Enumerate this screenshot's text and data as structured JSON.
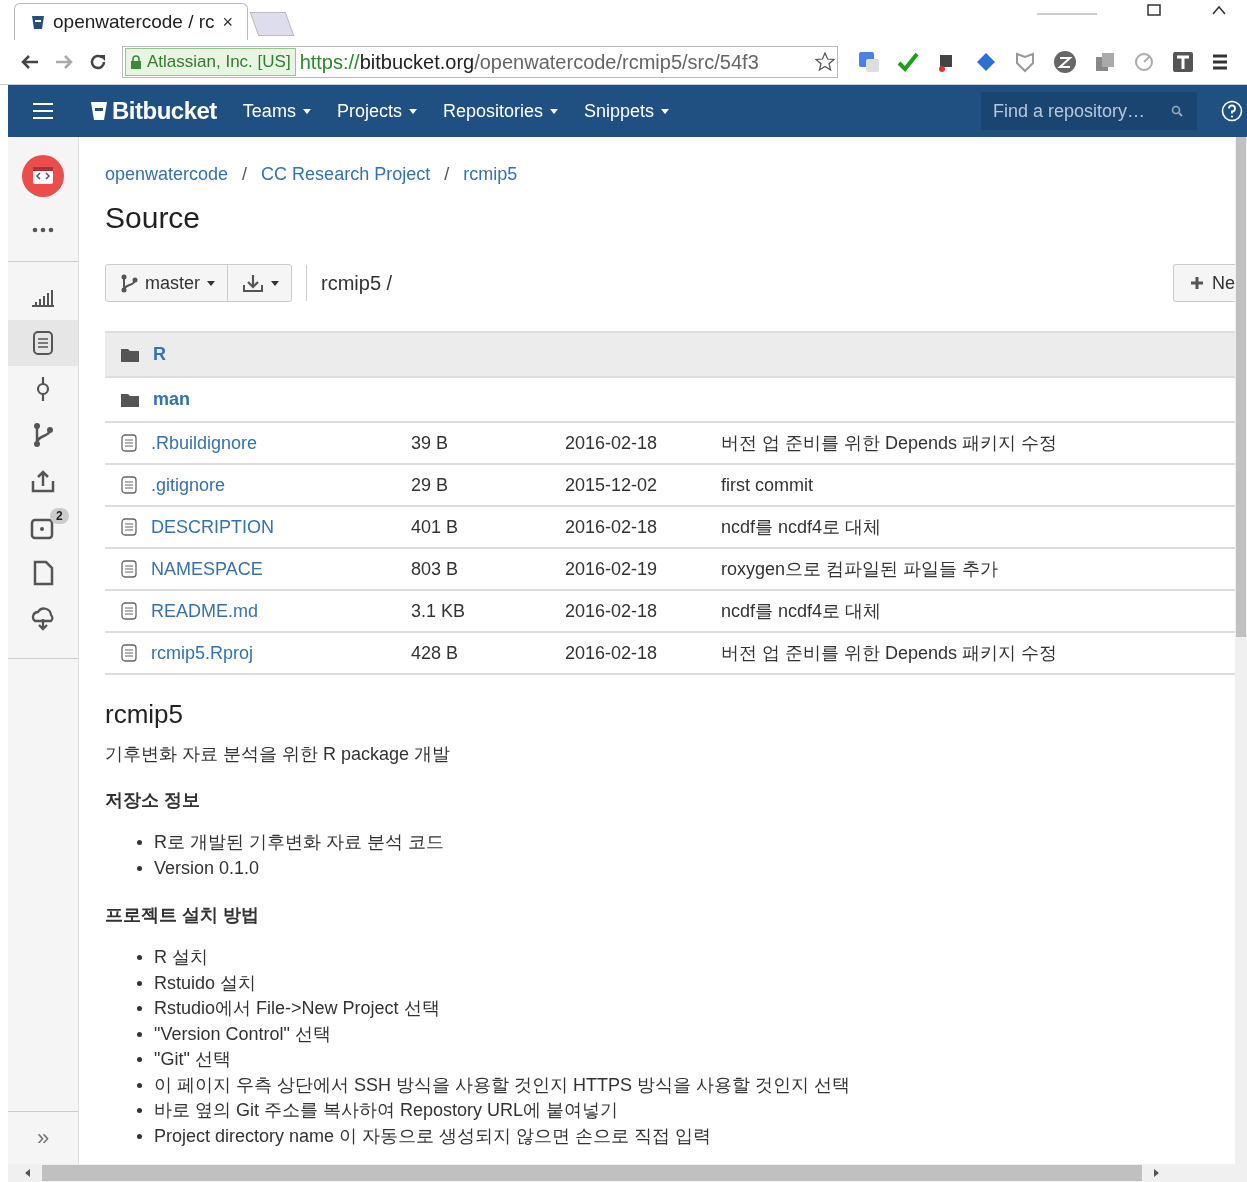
{
  "browser": {
    "tab_title": "openwatercode / rc",
    "close_tab": "×",
    "identity": "Atlassian, Inc. [US]",
    "url_scheme": "https://",
    "url_host": "bitbucket.org",
    "url_path": "/openwatercode/rcmip5/src/54f3"
  },
  "navbar": {
    "brand": "Bitbucket",
    "menus": [
      {
        "label": "Teams"
      },
      {
        "label": "Projects"
      },
      {
        "label": "Repositories"
      },
      {
        "label": "Snippets"
      }
    ],
    "search": {
      "placeholder": "Find a repository…"
    }
  },
  "sidebar": {
    "items": [
      {
        "kind": "stats",
        "selected": false
      },
      {
        "kind": "source",
        "selected": true
      },
      {
        "kind": "commits",
        "selected": false
      },
      {
        "kind": "branches",
        "selected": false
      },
      {
        "kind": "pull-requests",
        "selected": false
      },
      {
        "kind": "pipelines",
        "selected": false,
        "badge": "2"
      },
      {
        "kind": "downloads",
        "selected": false
      },
      {
        "kind": "deploy",
        "selected": false
      }
    ],
    "expand": "»"
  },
  "breadcrumbs": [
    "openwatercode",
    "CC Research Project",
    "rcmip5"
  ],
  "breadcrumb_separator": "/",
  "page_title": "Source",
  "toolbar": {
    "branch": "master",
    "path": "rcmip5 /",
    "new_button": "Ne"
  },
  "files": [
    {
      "kind": "folder",
      "name": "R",
      "selected": true
    },
    {
      "kind": "folder",
      "name": "man",
      "selected": false
    },
    {
      "kind": "file",
      "name": ".Rbuildignore",
      "size": "39 B",
      "date": "2016-02-18",
      "message": "버전 업 준비를 위한 Depends 패키지 수정",
      "selected": false
    },
    {
      "kind": "file",
      "name": ".gitignore",
      "size": "29 B",
      "date": "2015-12-02",
      "message": "first commit",
      "selected": false
    },
    {
      "kind": "file",
      "name": "DESCRIPTION",
      "size": "401 B",
      "date": "2016-02-18",
      "message": "ncdf를 ncdf4로 대체",
      "selected": false
    },
    {
      "kind": "file",
      "name": "NAMESPACE",
      "size": "803 B",
      "date": "2016-02-19",
      "message": "roxygen으로 컴파일된 파일들 추가",
      "selected": false
    },
    {
      "kind": "file",
      "name": "README.md",
      "size": "3.1 KB",
      "date": "2016-02-18",
      "message": "ncdf를 ncdf4로 대체",
      "selected": false
    },
    {
      "kind": "file",
      "name": "rcmip5.Rproj",
      "size": "428 B",
      "date": "2016-02-18",
      "message": "버전 업 준비를 위한 Depends 패키지 수정",
      "selected": false
    }
  ],
  "readme": {
    "title": "rcmip5",
    "intro": "기후변화 자료 분석을 위한 R package 개발",
    "sections": [
      {
        "heading": "저장소 정보",
        "items": [
          "R로 개발된 기후변화 자료 분석 코드",
          "Version 0.1.0"
        ]
      },
      {
        "heading": "프로젝트 설치 방법",
        "items": [
          "R 설치",
          "Rstuido 설치",
          "Rstudio에서 File->New Project 선택",
          "\"Version Control\" 선택",
          "\"Git\" 선택",
          "이 페이지 우측 상단에서 SSH 방식을 사용할 것인지 HTTPS 방식을 사용할 것인지 선택",
          "바로 옆의 Git 주소를 복사하여 Repostory URL에 붙여넣기",
          "Project directory name 이 자동으로 생성되지 않으면 손으로 직접 입력"
        ]
      }
    ]
  }
}
